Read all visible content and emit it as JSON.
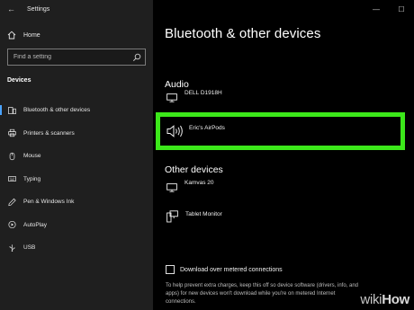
{
  "window": {
    "title": "Settings",
    "controls": {
      "minimize": "—",
      "maximize": "☐"
    }
  },
  "sidebar": {
    "home_label": "Home",
    "search_placeholder": "Find a setting",
    "section": "Devices",
    "items": [
      {
        "label": "Bluetooth & other devices",
        "icon": "bluetooth-devices-icon",
        "active": true
      },
      {
        "label": "Printers & scanners",
        "icon": "printer-icon",
        "active": false
      },
      {
        "label": "Mouse",
        "icon": "mouse-icon",
        "active": false
      },
      {
        "label": "Typing",
        "icon": "keyboard-icon",
        "active": false
      },
      {
        "label": "Pen & Windows Ink",
        "icon": "pen-icon",
        "active": false
      },
      {
        "label": "AutoPlay",
        "icon": "autoplay-icon",
        "active": false
      },
      {
        "label": "USB",
        "icon": "usb-icon",
        "active": false
      }
    ]
  },
  "main": {
    "title": "Bluetooth & other devices",
    "audio": {
      "heading": "Audio",
      "devices": [
        {
          "name": "DELL D1918H",
          "icon": "monitor-icon"
        },
        {
          "name": "Eric's AirPods",
          "icon": "speaker-icon",
          "highlighted": true
        }
      ]
    },
    "other": {
      "heading": "Other devices",
      "devices": [
        {
          "name": "Kamvas 20",
          "icon": "monitor-icon"
        },
        {
          "name": "Tablet Monitor",
          "icon": "tablet-monitor-icon"
        }
      ]
    },
    "metered": {
      "checkbox_label": "Download over metered connections",
      "checked": false,
      "help_text": "To help prevent extra charges, keep this off so device software (drivers, info, and apps) for new devices won't download while you're on metered Internet connections."
    }
  },
  "watermark": {
    "part1": "wiki",
    "part2": "How"
  },
  "colors": {
    "highlight": "#3ce81a",
    "accent": "#4aa3ff",
    "sidebar_bg": "#1f1f1f",
    "main_bg": "#000000"
  }
}
